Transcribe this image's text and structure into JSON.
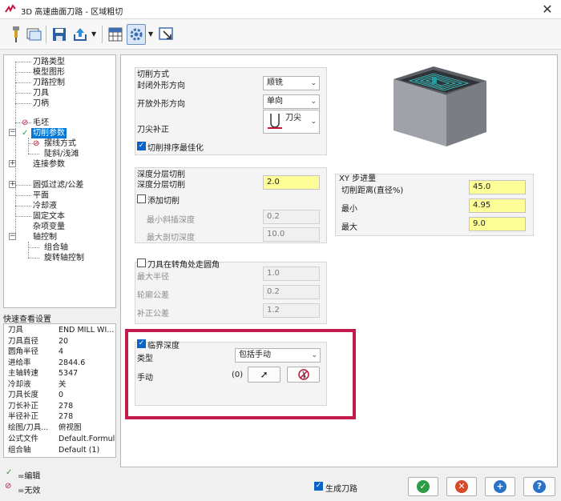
{
  "window": {
    "title": "3D 高速曲面刀路 - 区域粗切"
  },
  "tree": {
    "items": [
      "刀路类型",
      "模型图形",
      "刀路控制",
      "刀具",
      "刀柄",
      "毛坯",
      "切削参数",
      "摆线方式",
      "陡斜/浅滩",
      "连接参数",
      "圆弧过滤/公差",
      "平面",
      "冷却液",
      "固定文本",
      "杂项变量",
      "轴控制",
      "组合轴",
      "旋转轴控制"
    ]
  },
  "quickview": {
    "title": "快速查看设置",
    "rows": [
      {
        "k": "刀具",
        "v": "END MILL WI..."
      },
      {
        "k": "刀具直径",
        "v": "20"
      },
      {
        "k": "圆角半径",
        "v": "4"
      },
      {
        "k": "进给率",
        "v": "2844.6"
      },
      {
        "k": "主轴转速",
        "v": "5347"
      },
      {
        "k": "冷却液",
        "v": "关"
      },
      {
        "k": "刀具长度",
        "v": "0"
      },
      {
        "k": "刀长补正",
        "v": "278"
      },
      {
        "k": "半径补正",
        "v": "278"
      },
      {
        "k": "绘图/刀具...",
        "v": "俯视图"
      },
      {
        "k": "公式文件",
        "v": "Default.Formula"
      },
      {
        "k": "组合轴",
        "v": "Default (1)"
      }
    ]
  },
  "legend": {
    "edited": "=编辑",
    "invalid": "=无效"
  },
  "cut_method": {
    "title": "切削方式",
    "closed_label": "封闭外形方向",
    "closed_value": "顺铣",
    "open_label": "开放外形方向",
    "open_value": "单向",
    "tip_label": "刀尖补正",
    "tip_value": "刀尖",
    "optimize_label": "切削排序最佳化"
  },
  "depth": {
    "title": "深度分层切削",
    "step_label": "深度分层切削",
    "step_value": "2.0",
    "add_label": "添加切削",
    "min_ramp_label": "最小斜插深度",
    "min_ramp_value": "0.2",
    "max_cut_label": "最大剖切深度",
    "max_cut_value": "10.0"
  },
  "xy": {
    "title": "XY 步进量",
    "dist_label": "切削距离(直径%)",
    "dist_value": "45.0",
    "min_label": "最小",
    "min_value": "4.95",
    "max_label": "最大",
    "max_value": "9.0"
  },
  "corner": {
    "title": "刀具在转角处走圆角",
    "maxr_label": "最大半径",
    "maxr_value": "1.0",
    "tol_label": "轮廓公差",
    "tol_value": "0.2",
    "comp_label": "补正公差",
    "comp_value": "1.2"
  },
  "critical": {
    "title": "临界深度",
    "type_label": "类型",
    "type_value": "包括手动",
    "manual_label": "手动",
    "manual_count": "(0)"
  },
  "footer": {
    "generate_label": "生成刀路",
    "ok_color": "#2e9b45",
    "cancel_color": "#d64a2a",
    "add_color": "#2a72c8",
    "help_color": "#2a72c8"
  }
}
